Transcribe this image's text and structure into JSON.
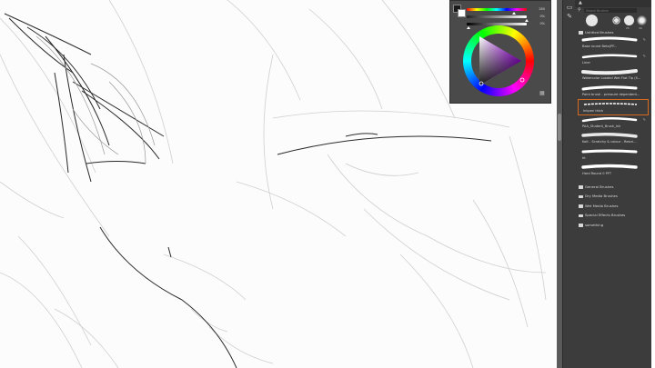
{
  "color_panel": {
    "fg_color": "#1a1a1a",
    "bg_color": "#ffffff",
    "sliders": [
      {
        "name": "hue",
        "value": "280",
        "level": 0.78
      },
      {
        "name": "saturation",
        "value": "0%",
        "level": 0.96
      },
      {
        "name": "brightness",
        "value": "0%",
        "level": 0.02
      }
    ]
  },
  "search": {
    "placeholder": "Search Brushes"
  },
  "brush_tips": [
    "",
    "",
    "",
    "25",
    "30"
  ],
  "brush_groups": [
    {
      "label": "Untitled Brushes",
      "brushes": [
        {
          "name": "Base round Beta(PF..."
        },
        {
          "name": "Liner"
        },
        {
          "name": "Watercolor Loaded Wet Flat Tip (S..."
        },
        {
          "name": "Paint brush - pressure dependent..."
        },
        {
          "name": "Inkpen thick",
          "selected": true
        },
        {
          "name": "PAA_Student_Brush_Ink"
        },
        {
          "name": "Kolt - Scratchy & colour - Resizi..."
        },
        {
          "name": "ht"
        },
        {
          "name": "Hard Round 0 PFT"
        }
      ]
    }
  ],
  "folders": [
    {
      "label": "General Brushes"
    },
    {
      "label": "Dry Media Brushes"
    },
    {
      "label": "Wet Media Brushes"
    },
    {
      "label": "Special Effects Brushes"
    },
    {
      "label": "something"
    }
  ]
}
